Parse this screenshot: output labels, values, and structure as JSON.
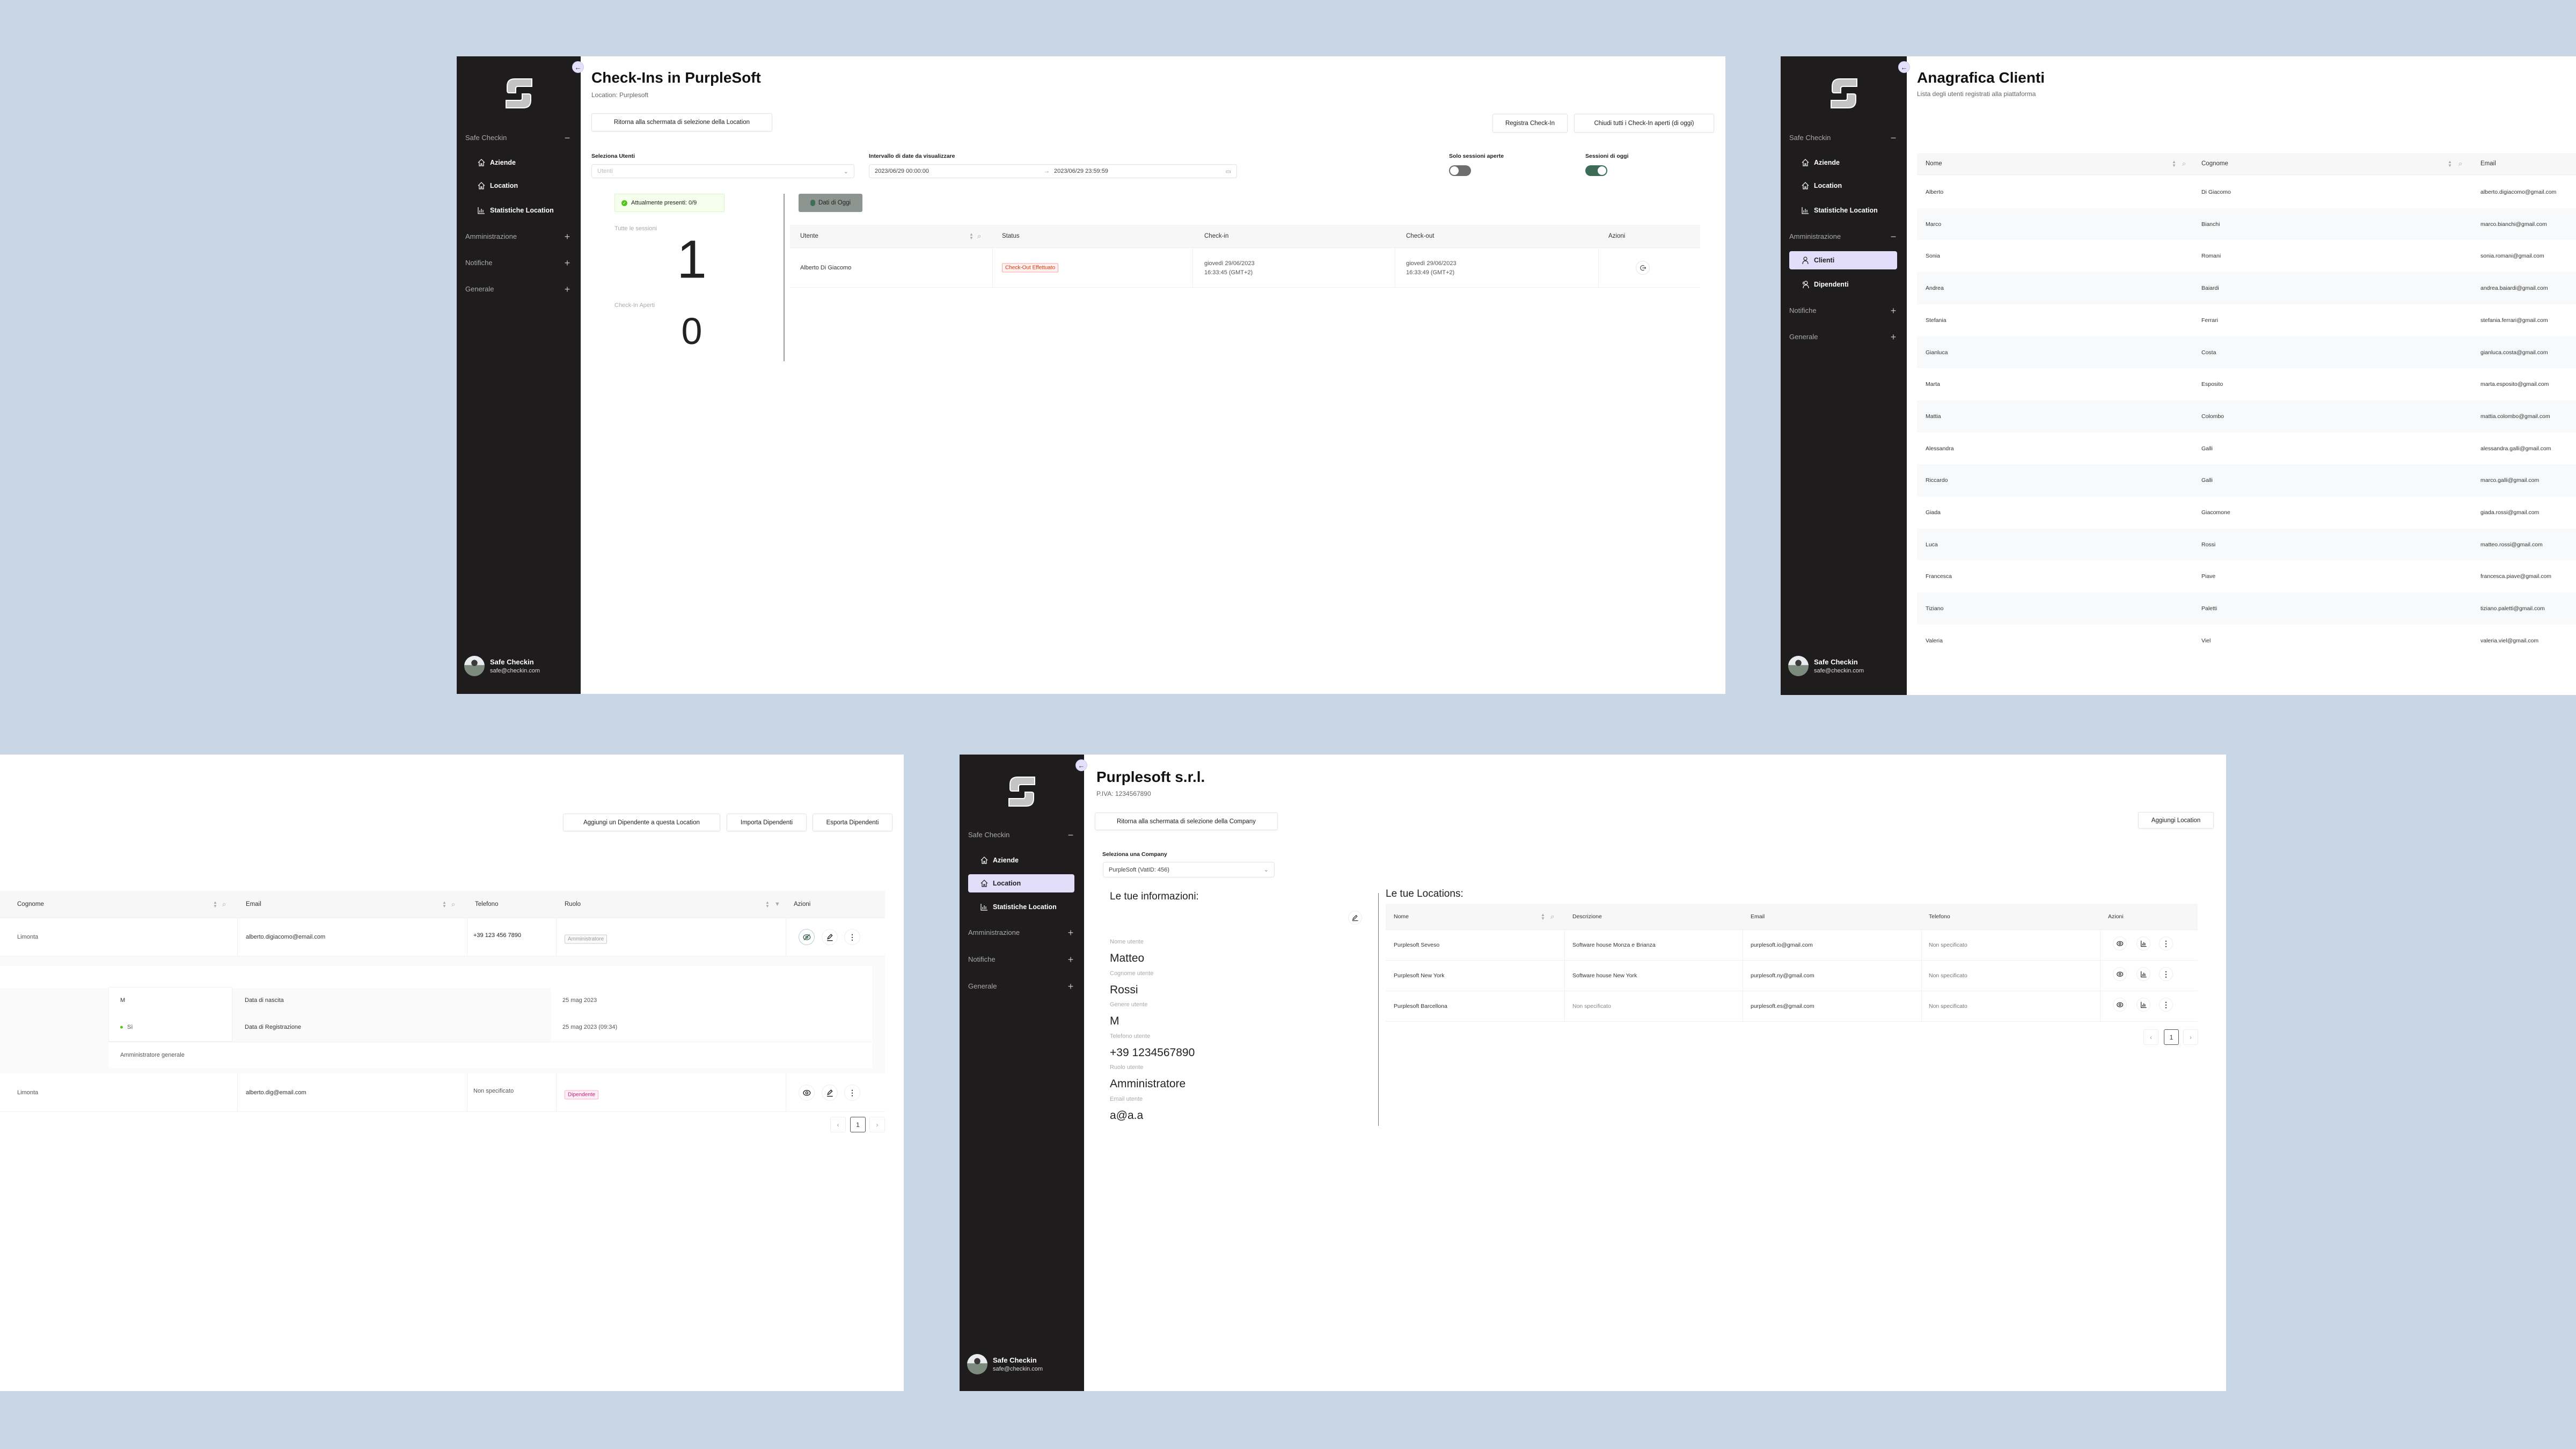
{
  "sidebar": {
    "groups": {
      "safe_checkin": "Safe Checkin",
      "administration": "Amministrazione",
      "notifications": "Notifiche",
      "general": "Generale"
    },
    "items": {
      "companies": "Aziende",
      "location": "Location",
      "stats": "Statistiche Location",
      "clients": "Clienti",
      "employees": "Dipendenti"
    },
    "user": {
      "name": "Safe Checkin",
      "email": "safe@checkin.com"
    }
  },
  "checkins": {
    "title": "Check-Ins in PurpleSoft",
    "subtitle": "Location: Purplesoft",
    "back_button": "Ritorna alla schermata di selezione della Location",
    "register_button": "Registra Check-In",
    "close_all_button": "Chiudi tutti i Check-In aperti (di oggi)",
    "users_label": "Seleziona Utenti",
    "users_placeholder": "Utenti",
    "date_range_label": "Intervallo di date da visualizzare",
    "date_from": "2023/06/29 00:00:00",
    "date_to": "2023/06/29 23:59:59",
    "open_only_label": "Solo sessioni aperte",
    "open_only": false,
    "today_label": "Sessioni di oggi",
    "today": true,
    "present_badge": "Attualmente presenti: 0/9",
    "all_sessions_label": "Tutte le sessioni",
    "all_sessions_count": "1",
    "open_label": "Check-In Aperti",
    "open_count": "0",
    "today_button": "Dati di Oggi",
    "columns": [
      "Utente",
      "Status",
      "Check-in",
      "Check-out",
      "Azioni"
    ],
    "rows": [
      {
        "user": "Alberto Di Giacomo",
        "status": "Check-Out Effettuato",
        "checkin_date": "giovedì 29/06/2023",
        "checkin_time": "16:33:45 (GMT+2)",
        "checkout_date": "giovedì 29/06/2023",
        "checkout_time": "16:33:49 (GMT+2)"
      }
    ]
  },
  "clients": {
    "title": "Anagrafica Clienti",
    "subtitle": "Lista degli utenti registrati alla piattaforma",
    "columns": [
      "Nome",
      "Cognome",
      "Email"
    ],
    "rows": [
      {
        "first": "Alberto",
        "last": "Di Giacomo",
        "email": "alberto.digiacomo@gmail.com"
      },
      {
        "first": "Marco",
        "last": "Bianchi",
        "email": "marco.bianchi@gmail.com"
      },
      {
        "first": "Sonia",
        "last": "Romani",
        "email": "sonia.romani@gmail.com"
      },
      {
        "first": "Andrea",
        "last": "Baiardi",
        "email": "andrea.baiardi@gmail.com"
      },
      {
        "first": "Stefania",
        "last": "Ferrari",
        "email": "stefania.ferrari@gmail.com"
      },
      {
        "first": "Gianluca",
        "last": "Costa",
        "email": "gianluca.costa@gmail.com"
      },
      {
        "first": "Marta",
        "last": "Esposito",
        "email": "marta.esposito@gmail.com"
      },
      {
        "first": "Mattia",
        "last": "Colombo",
        "email": "mattia.colombo@gmail.com"
      },
      {
        "first": "Alessandra",
        "last": "Galli",
        "email": "alessandra.galli@gmail.com"
      },
      {
        "first": "Riccardo",
        "last": "Galli",
        "email": "marco.galli@gmail.com"
      },
      {
        "first": "Giada",
        "last": "Giacomone",
        "email": "giada.rossi@gmail.com"
      },
      {
        "first": "Luca",
        "last": "Rossi",
        "email": "matteo.rossi@gmail.com"
      },
      {
        "first": "Francesca",
        "last": "Piave",
        "email": "francesca.piave@gmail.com"
      },
      {
        "first": "Tiziano",
        "last": "Paletti",
        "email": "tiziano.paletti@gmail.com"
      },
      {
        "first": "Valeria",
        "last": "Viel",
        "email": "valeria.viel@gmail.com"
      }
    ]
  },
  "employees": {
    "add_button": "Aggiungi un Dipendente a questa Location",
    "import_button": "Importa Dipendenti",
    "export_button": "Esporta Dipendenti",
    "columns": [
      "Cognome",
      "Email",
      "Telefono",
      "Ruolo",
      "Azioni"
    ],
    "rows": [
      {
        "last": "Limonta",
        "email": "alberto.digiacomo@email.com",
        "phone": "+39 123 456 7890",
        "role": "Amministratore"
      },
      {
        "last": "Limonta",
        "email": "alberto.dig@email.com",
        "phone": "Non specificato",
        "role": "Dipendente"
      }
    ],
    "expanded": {
      "gender": "M",
      "active": "Sì",
      "birth_label": "Data di nascita",
      "birth": "25 mag 2023",
      "registration_label": "Data di Registrazione",
      "registration": "25 mag 2023 (09:34)",
      "role_description": "Amministratore generale"
    },
    "page": "1"
  },
  "company": {
    "title": "Purplesoft s.r.l.",
    "vat": "P.IVA: 1234567890",
    "back_button": "Ritorna alla schermata di selezione della Company",
    "select_label": "Seleziona una Company",
    "select_value": "PurpleSoft (VatID: 456)",
    "info_title": "Le tue informazioni:",
    "fields": [
      {
        "label": "Nome utente",
        "value": "Matteo"
      },
      {
        "label": "Cognome utente",
        "value": "Rossi"
      },
      {
        "label": "Genere utente",
        "value": "M"
      },
      {
        "label": "Telefono utente",
        "value": "+39 1234567890"
      },
      {
        "label": "Ruolo utente",
        "value": "Amministratore"
      },
      {
        "label": "Email utente",
        "value": "a@a.a"
      }
    ],
    "locations_title": "Le tue Locations:",
    "add_button": "Aggiungi Location",
    "columns": [
      "Nome",
      "Descrizione",
      "Email",
      "Telefono",
      "Azioni"
    ],
    "rows": [
      {
        "name": "Purplesoft Seveso",
        "description": "Software house Monza e Brianza",
        "email": "purplesoft.io@gmail.com",
        "phone": "Non specificato"
      },
      {
        "name": "Purplesoft New York",
        "description": "Software house New York",
        "email": "purplesoft.ny@gmail.com",
        "phone": "Non specificato"
      },
      {
        "name": "Purplesoft Barcellona",
        "description": "Non specificato",
        "email": "purplesoft.es@gmail.com",
        "phone": "Non specificato"
      }
    ],
    "page": "1"
  },
  "colors": {
    "background": "#c9d6e6",
    "sidebar": "#1e1c1d",
    "active_item": "#e2defa",
    "toggle_on": "#3d6b57",
    "toggle_off": "#6e6e6e",
    "today_button": "#8c9590"
  }
}
